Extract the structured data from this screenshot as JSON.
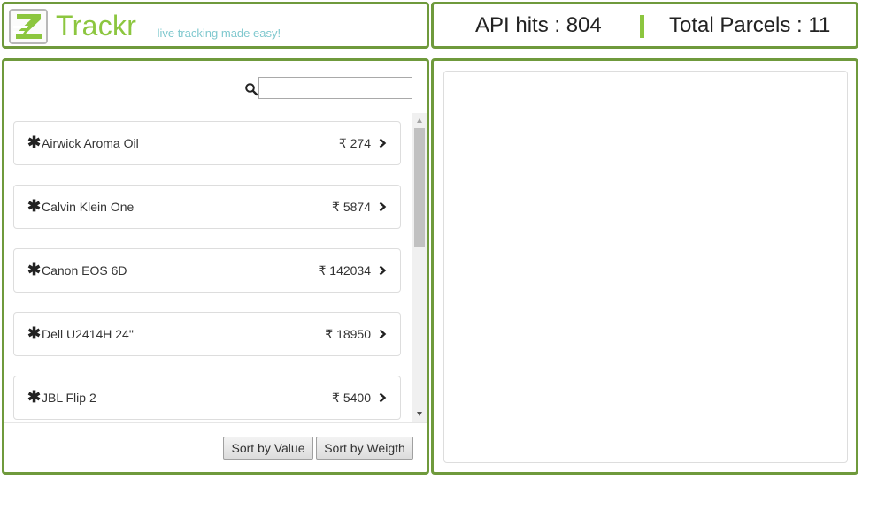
{
  "brand": {
    "name": "Trackr",
    "tagline": "— live tracking made easy!",
    "logo_letter": "Z"
  },
  "stats": {
    "api_hits_label": "API hits : 804",
    "total_parcels_label": "Total Parcels : 11"
  },
  "search": {
    "value": "",
    "placeholder": ""
  },
  "parcels": [
    {
      "name": "Airwick Aroma Oil",
      "price": "₹ 274"
    },
    {
      "name": "Calvin Klein One",
      "price": "₹ 5874"
    },
    {
      "name": "Canon EOS 6D",
      "price": "₹ 142034"
    },
    {
      "name": "Dell U2414H 24\"",
      "price": "₹ 18950"
    },
    {
      "name": "JBL Flip 2",
      "price": "₹ 5400"
    }
  ],
  "sort": {
    "by_value_label": "Sort by Value",
    "by_weight_label": "Sort by Weigth"
  },
  "colors": {
    "panel_border": "#6f9a3c",
    "brand_green": "#8cc63f",
    "tagline_teal": "#7fc8ce"
  },
  "icons": {
    "item_marker": "asterisk-icon",
    "item_open": "chevron-right-icon",
    "search": "search-icon"
  }
}
